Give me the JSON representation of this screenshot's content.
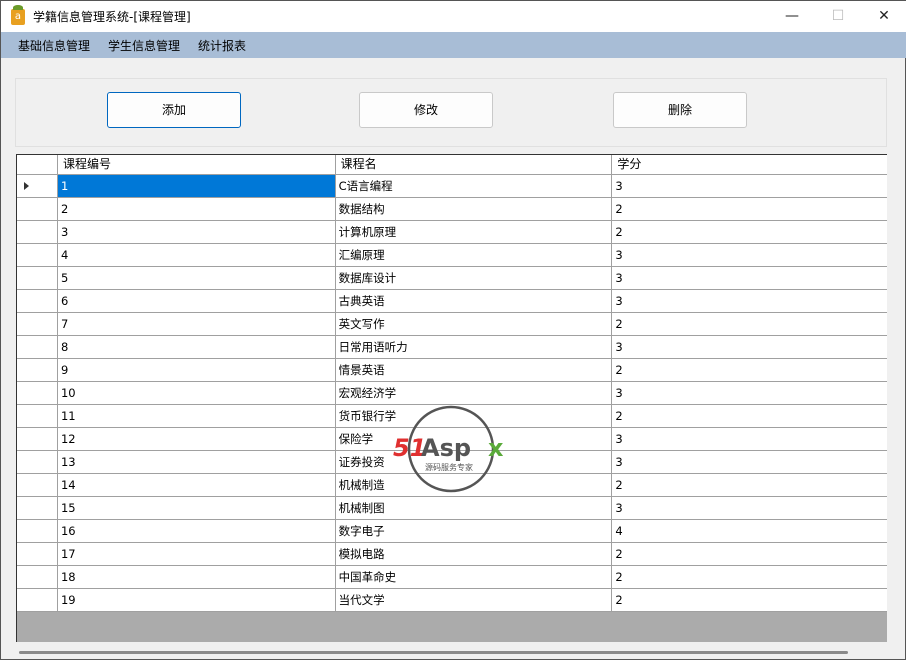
{
  "window": {
    "title": "学籍信息管理系统-[课程管理]",
    "icon_letter": "a",
    "minimize": "—",
    "maximize": "☐",
    "close": "✕"
  },
  "menu": [
    "基础信息管理",
    "学生信息管理",
    "统计报表"
  ],
  "toolbar": {
    "add": "添加",
    "edit": "修改",
    "delete": "删除"
  },
  "grid": {
    "columns": [
      "课程编号",
      "课程名",
      "学分"
    ],
    "rows": [
      [
        "1",
        "C语言编程",
        "3"
      ],
      [
        "2",
        "数据结构",
        "2"
      ],
      [
        "3",
        "计算机原理",
        "2"
      ],
      [
        "4",
        "汇编原理",
        "3"
      ],
      [
        "5",
        "数据库设计",
        "3"
      ],
      [
        "6",
        "古典英语",
        "3"
      ],
      [
        "7",
        "英文写作",
        "2"
      ],
      [
        "8",
        "日常用语听力",
        "3"
      ],
      [
        "9",
        "情景英语",
        "2"
      ],
      [
        "10",
        "宏观经济学",
        "3"
      ],
      [
        "11",
        "货币银行学",
        "2"
      ],
      [
        "12",
        "保险学",
        "3"
      ],
      [
        "13",
        "证券投资",
        "3"
      ],
      [
        "14",
        "机械制造",
        "2"
      ],
      [
        "15",
        "机械制图",
        "3"
      ],
      [
        "16",
        "数字电子",
        "4"
      ],
      [
        "17",
        "模拟电路",
        "2"
      ],
      [
        "18",
        "中国革命史",
        "2"
      ],
      [
        "19",
        "当代文学",
        "2"
      ]
    ],
    "selected_row": 0
  },
  "watermark": {
    "brand": "51Aspx",
    "tagline": "源码服务专家"
  }
}
